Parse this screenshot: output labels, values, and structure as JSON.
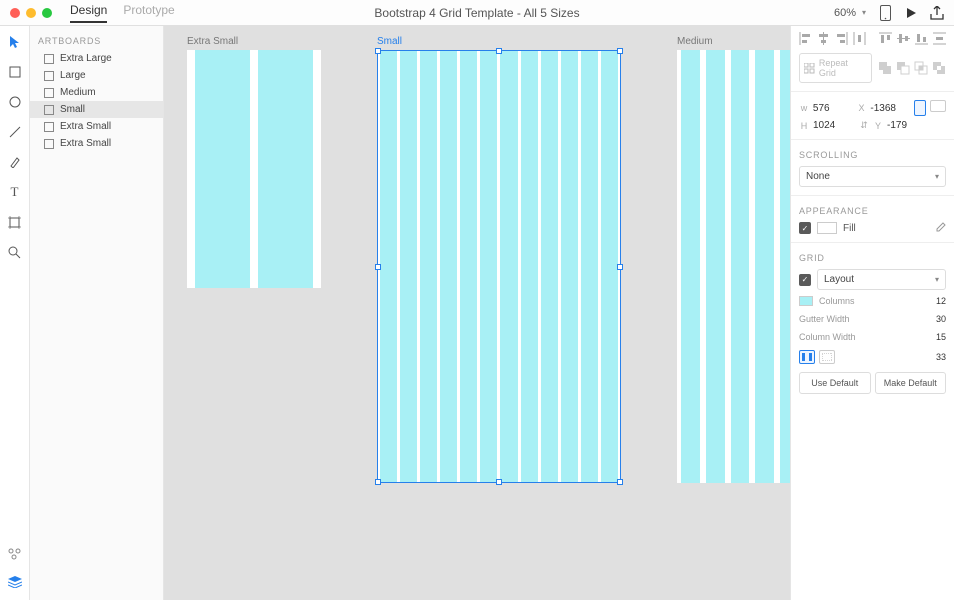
{
  "app": {
    "tabs": [
      "Design",
      "Prototype"
    ],
    "active_tab": "Design",
    "title": "Bootstrap 4 Grid Template - All 5 Sizes",
    "zoom": "60%"
  },
  "layers": {
    "header": "ARTBOARDS",
    "items": [
      {
        "name": "Extra Large"
      },
      {
        "name": "Large"
      },
      {
        "name": "Medium"
      },
      {
        "name": "Small",
        "selected": true
      },
      {
        "name": "Extra Small"
      },
      {
        "name": "Extra Small"
      }
    ]
  },
  "canvas": {
    "artboards": {
      "xs": {
        "label": "Extra Small"
      },
      "sm": {
        "label": "Small"
      },
      "md": {
        "label": "Medium"
      }
    }
  },
  "inspector": {
    "repeat_grid": "Repeat Grid",
    "w": "576",
    "x": "-1368",
    "h": "1024",
    "y": "-179",
    "scrolling_hdr": "SCROLLING",
    "scrolling_val": "None",
    "appearance_hdr": "APPEARANCE",
    "fill_label": "Fill",
    "grid_hdr": "GRID",
    "grid_type": "Layout",
    "columns_lbl": "Columns",
    "columns_val": "12",
    "gutter_lbl": "Gutter Width",
    "gutter_val": "30",
    "colw_lbl": "Column Width",
    "colw_val": "15",
    "margin_val": "33",
    "use_default": "Use Default",
    "make_default": "Make Default"
  }
}
